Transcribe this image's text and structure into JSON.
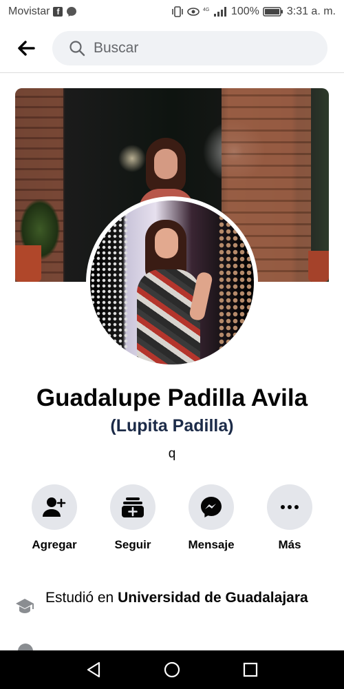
{
  "status_bar": {
    "carrier": "Movistar",
    "battery": "100%",
    "network": "4G",
    "time": "3:31 a. m."
  },
  "top_bar": {
    "search_placeholder": "Buscar"
  },
  "profile": {
    "name": "Guadalupe Padilla Avila",
    "alternate_name": "(Lupita Padilla)",
    "bio": "q"
  },
  "actions": [
    {
      "label": "Agregar",
      "icon": "add-friend-icon"
    },
    {
      "label": "Seguir",
      "icon": "follow-icon"
    },
    {
      "label": "Mensaje",
      "icon": "messenger-icon"
    },
    {
      "label": "Más",
      "icon": "more-icon"
    }
  ],
  "intro": {
    "education_prefix": "Estudió en ",
    "education_school": "Universidad de Guadalajara"
  },
  "colors": {
    "button_bg": "#e4e6eb",
    "search_bg": "#f0f2f5",
    "text": "#050505",
    "alt_name": "#1c2b48"
  }
}
